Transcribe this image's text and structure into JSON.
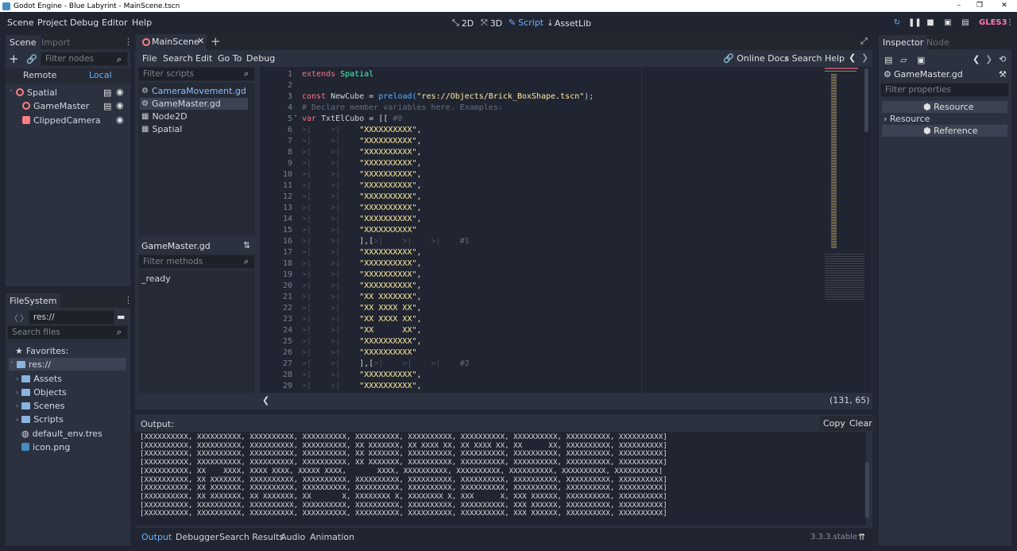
{
  "window": {
    "title": "Godot Engine - Blue Labyrint - MainScene.tscn",
    "buttons": [
      "–",
      "❐",
      "✕"
    ]
  },
  "menu": {
    "items": [
      "Scene",
      "Project",
      "Debug",
      "Editor",
      "Help"
    ]
  },
  "workspaces": {
    "items": [
      "2D",
      "3D",
      "Script",
      "AssetLib"
    ],
    "active": "Script"
  },
  "renderer": "GLES3",
  "scene_dock": {
    "tabs": [
      "Scene",
      "Import"
    ],
    "filter_placeholder": "Filter nodes",
    "remote": "Remote",
    "local": "Local",
    "nodes": [
      {
        "name": "Spatial"
      },
      {
        "name": "GameMaster"
      },
      {
        "name": "ClippedCamera"
      }
    ]
  },
  "filesystem": {
    "title": "FileSystem",
    "path": "res://",
    "search_placeholder": "Search files",
    "favorites": "Favorites:",
    "root": "res://",
    "items": [
      "Assets",
      "Objects",
      "Scenes",
      "Scripts",
      "default_env.tres",
      "icon.png"
    ]
  },
  "scene_tabs": {
    "active": "MainScene"
  },
  "script_menu": {
    "items": [
      "File",
      "Search",
      "Edit",
      "Go To",
      "Debug"
    ],
    "online_docs": "Online Docs",
    "search_help": "Search Help"
  },
  "scripts_panel": {
    "filter_placeholder": "Filter scripts",
    "scripts": [
      "CameraMovement.gd",
      "GameMaster.gd",
      "Node2D",
      "Spatial"
    ],
    "current": "GameMaster.gd",
    "methods_placeholder": "Filter methods",
    "methods": [
      "_ready"
    ]
  },
  "editor": {
    "line_numbers": [
      "1",
      "2",
      "3",
      "4",
      "5",
      "6",
      "7",
      "8",
      "9",
      "10",
      "11",
      "12",
      "13",
      "14",
      "15",
      "16",
      "17",
      "18",
      "19",
      "20",
      "21",
      "22",
      "23",
      "24",
      "25",
      "26",
      "27",
      "28",
      "29"
    ],
    "code": {
      "l1_kw": "extends",
      "l1_ty": "Spatial",
      "l3_kw": "const",
      "l3_name": "NewCube = ",
      "l3_fn": "preload(",
      "l3_str": "\"res://Objects/Brick_BoxShape.tscn\"",
      "l3_end": ");",
      "l4": "# Declare member variables here. Examples:",
      "l5_kw": "var",
      "l5_name": "TxtElCubo = [[",
      "l5_cm": "#0",
      "rows": [
        "\"XXXXXXXXXX\",",
        "\"XXXXXXXXXX\",",
        "\"XXXXXXXXXX\",",
        "\"XXXXXXXXXX\",",
        "\"XXXXXXXXXX\",",
        "\"XXXXXXXXXX\",",
        "\"XXXXXXXXXX\",",
        "\"XXXXXXXXXX\",",
        "\"XXXXXXXXXX\",",
        "\"XXXXXXXXXX\""
      ],
      "l16": "],[",
      "l16_cm": "#1",
      "rows2": [
        "\"XXXXXXXXXX\",",
        "\"XXXXXXXXXX\",",
        "\"XXXXXXXXXX\",",
        "\"XXXXXXXXXX\",",
        "\"XX XXXXXXX\",",
        "\"XX XXXX XX\",",
        "\"XX XXXX XX\",",
        "\"XX      XX\",",
        "\"XXXXXXXXXX\",",
        "\"XXXXXXXXXX\""
      ],
      "l27": "],[",
      "l27_cm": "#2",
      "rows3": [
        "\"XXXXXXXXXX\",",
        "\"XXXXXXXXXX\","
      ]
    },
    "cursor": "(131, 65)"
  },
  "inspector": {
    "tabs": [
      "Inspector",
      "Node"
    ],
    "object": "GameMaster.gd",
    "filter_placeholder": "Filter properties",
    "sections": [
      "Resource",
      "Resource",
      "Reference"
    ]
  },
  "output": {
    "title": "Output:",
    "copy": "Copy",
    "clear": "Clear",
    "lines": [
      "[XXXXXXXXXX, XXXXXXXXXX, XXXXXXXXXX, XXXXXXXXXX, XXXXXXXXXX, XXXXXXXXXX, XXXXXXXXXX, XXXXXXXXXX, XXXXXXXXXX, XXXXXXXXXX]",
      "[XXXXXXXXXX, XXXXXXXXXX, XXXXXXXXXX, XXXXXXXXXX, XX XXXXXXX, XX XXXX XX, XX XXXX XX, XX      XX, XXXXXXXXXX, XXXXXXXXXX]",
      "[XXXXXXXXXX, XXXXXXXXXX, XXXXXXXXXX, XXXXXXXXXX, XX XXXXXXX, XXXXXXXXXX, XXXXXXXXXX, XXXXXXXXXX, XXXXXXXXXX, XXXXXXXXXX]",
      "[XXXXXXXXXX, XXXXXXXXXX, XXXXXXXXXX, XXXXXXXXXX, XX XXXXXXX, XXXXXXXXXX, XXXXXXXXXX, XXXXXXXXXX, XXXXXXXXXX, XXXXXXXXXX]",
      "[XXXXXXXXXX, XX    XXXX, XXXX XXXX, XXXXX XXXX,       XXXX, XXXXXXXXXX, XXXXXXXXXX, XXXXXXXXXX, XXXXXXXXXX, XXXXXXXXXX]",
      "[XXXXXXXXXX, XX XXXXXXX, XXXXXXXXXX, XXXXXXXXXX, XXXXXXXXXX, XXXXXXXXXX, XXXXXXXXXX, XXXXXXXXXX, XXXXXXXXXX, XXXXXXXXXX]",
      "[XXXXXXXXXX, XX XXXXXXX, XXXXXXXXXX, XXXXXXXXXX, XXXXXXXXXX, XXXXXXXXXX, XXXXXXXXXX, XXXXXXXXXX, XXXXXXXXXX, XXXXXXXXXX]",
      "[XXXXXXXXXX, XX XXXXXXX, XX XXXXXXX, XX       X, XXXXXXXX X, XXXXXXXX X, XXX      X, XXX XXXXXX, XXXXXXXXXX, XXXXXXXXXX]",
      "[XXXXXXXXXX, XXXXXXXXXX, XXXXXXXXXX, XXXXXXXXXX, XXXXXXXXXX, XXXXXXXXXX, XXXXXXXXXX, XXX XXXXXX, XXXXXXXXXX, XXXXXXXXXX]",
      "[XXXXXXXXXX, XXXXXXXXXX, XXXXXXXXXX, XXXXXXXXXX, XXXXXXXXXX, XXXXXXXXXX, XXXXXXXXXX, XXX XXXXXX, XXXXXXXXXX, XXXXXXXXXX]"
    ]
  },
  "bottom_tabs": {
    "items": [
      "Output",
      "Debugger",
      "Search Results",
      "Audio",
      "Animation"
    ],
    "active": "Output"
  },
  "version": "3.3.3.stable"
}
